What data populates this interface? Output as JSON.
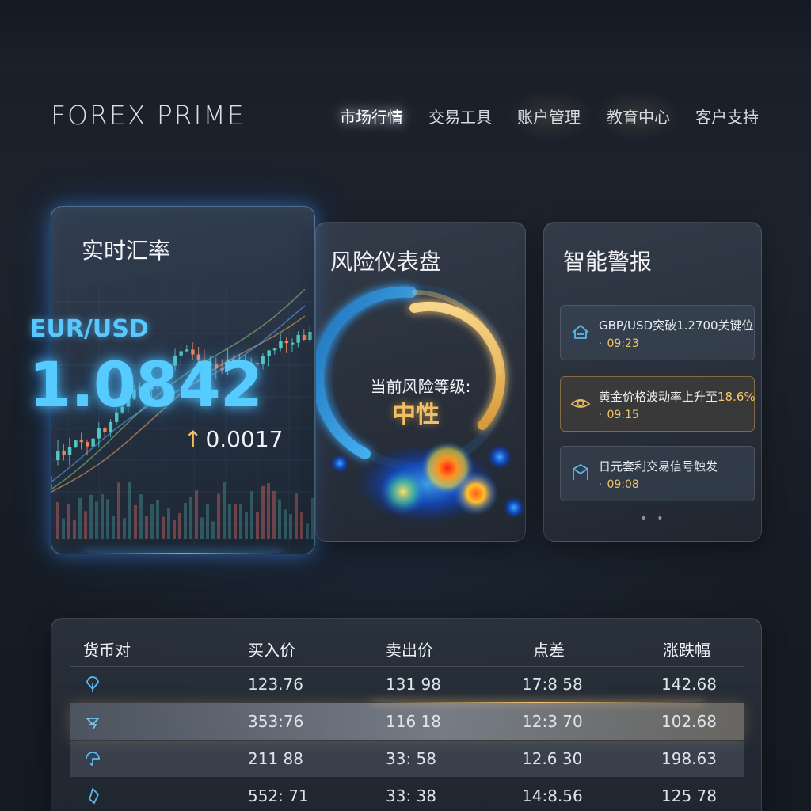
{
  "brand": "FOREX PRIME",
  "nav": [
    {
      "label": "市场行情",
      "active": true
    },
    {
      "label": "交易工具",
      "active": false
    },
    {
      "label": "账户管理",
      "active": false
    },
    {
      "label": "教育中心",
      "active": false
    },
    {
      "label": "客户支持",
      "active": false
    }
  ],
  "rate_card": {
    "title": "实时汇率",
    "pair": "EUR/USD",
    "rate": "1.0842",
    "change": "0.0017",
    "change_direction": "up",
    "icons": {
      "change": "arrow-up-icon"
    },
    "colors": {
      "rate": "#56cbff",
      "arrow": "#f0c060",
      "candle_up": "#58d0c8",
      "candle_down": "#ff8a5a"
    }
  },
  "risk_card": {
    "title": "风险仪表盘",
    "caption": "当前风险等级:",
    "level": "中性",
    "gauge_fraction": 0.5,
    "colors": {
      "low": "#3aa8ff",
      "high": "#f3c06a",
      "hot": "#ff3020"
    }
  },
  "alerts_card": {
    "title": "智能警报",
    "items": [
      {
        "icon": "bull-icon",
        "text": "GBP/USD突破1.2700关键位",
        "highlight": "",
        "time": "09:23",
        "accent": "blue"
      },
      {
        "icon": "eye-icon",
        "text": "黄金价格波动率上升至",
        "highlight": "18.6%",
        "time": "09:15",
        "accent": "gold"
      },
      {
        "icon": "signal-icon",
        "text": "日元套利交易信号触发",
        "highlight": "",
        "time": "09:08",
        "accent": "blue"
      }
    ],
    "more": "• •"
  },
  "table": {
    "headers": [
      "货币对",
      "买入价",
      "卖出价",
      "点差",
      "涨跌幅"
    ],
    "rows": [
      {
        "icon": "currency-icon",
        "bid": "123.76",
        "ask": "131 98",
        "spread": "17:8 58",
        "change": "142.68",
        "style": "plain"
      },
      {
        "icon": "currency-icon",
        "bid": "353:76",
        "ask": "116 18",
        "spread": "12:3 70",
        "change": "102.68",
        "style": "highlight"
      },
      {
        "icon": "currency-icon",
        "bid": "211 88",
        "ask": "33: 58",
        "spread": "12.6 30",
        "change": "198.63",
        "style": "alt"
      },
      {
        "icon": "currency-icon",
        "bid": "552: 71",
        "ask": "33: 38",
        "spread": "14:8.56",
        "change": "125 78",
        "style": "plain"
      }
    ]
  }
}
